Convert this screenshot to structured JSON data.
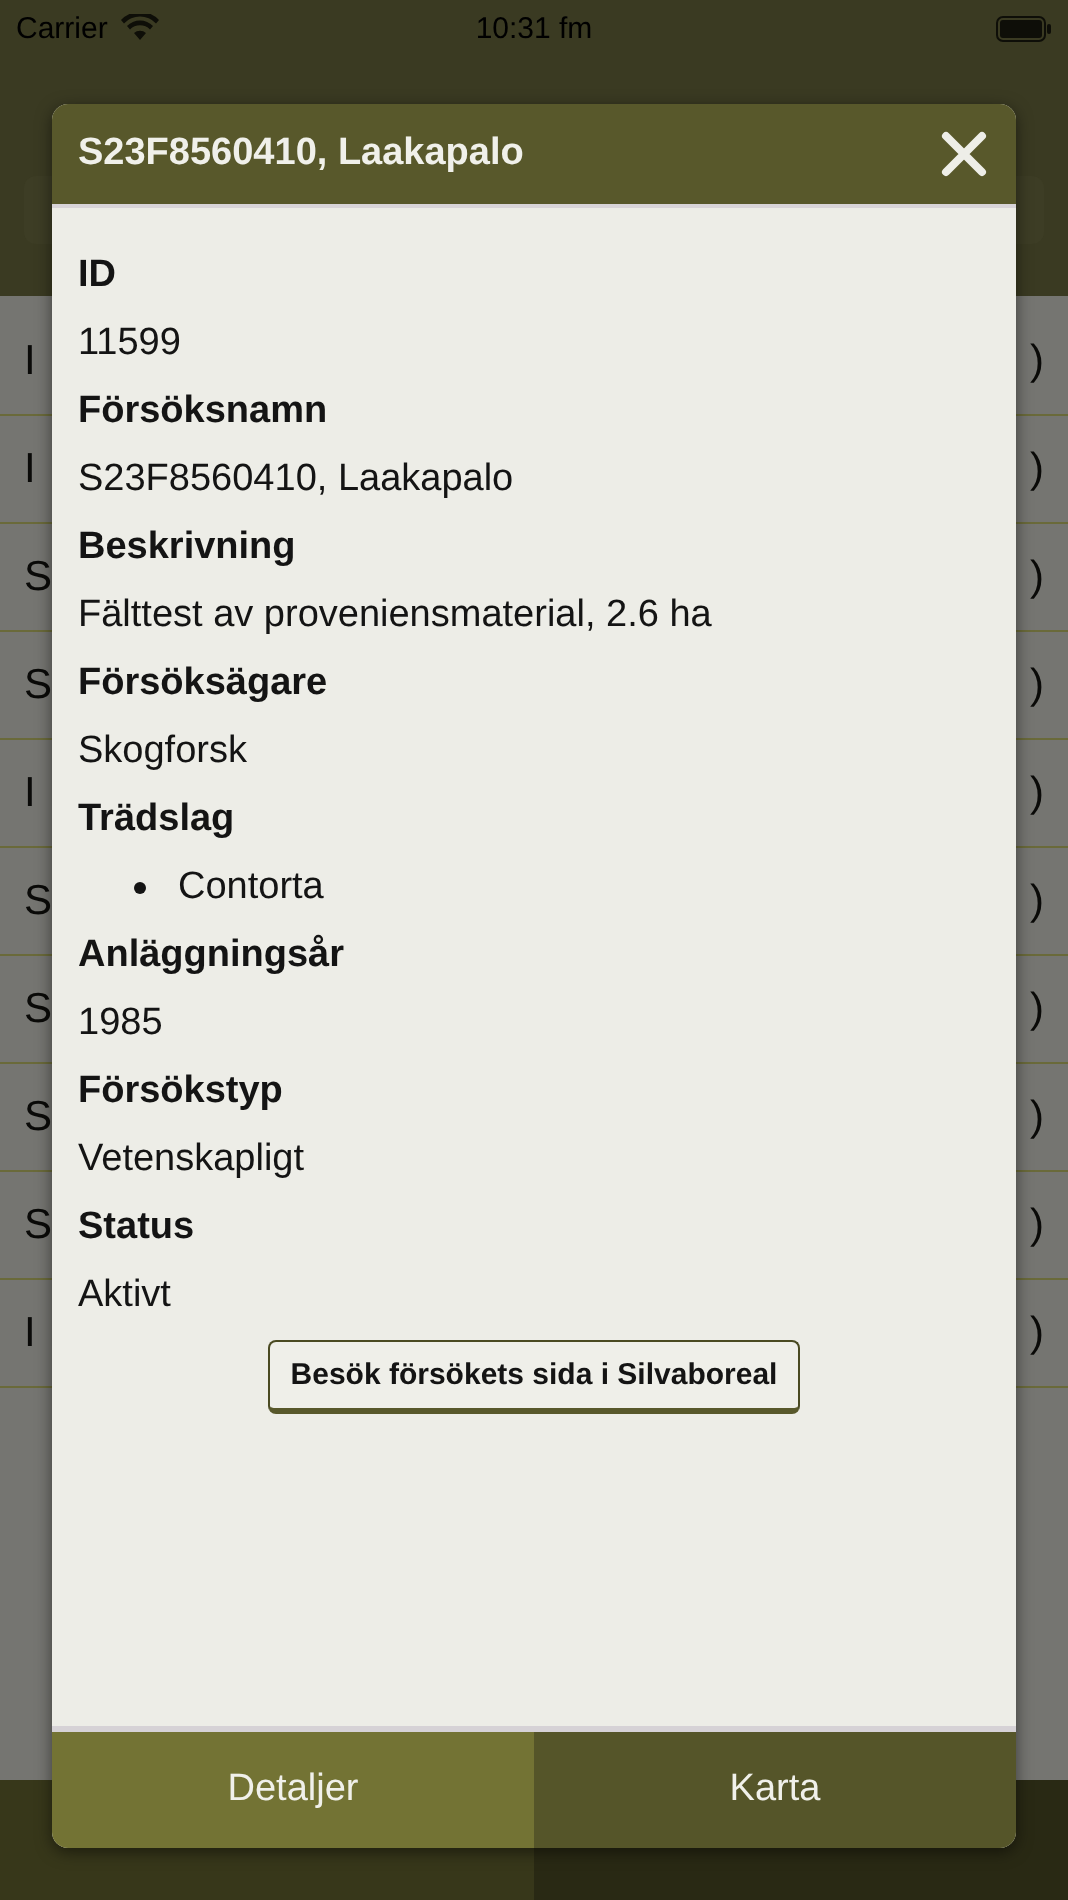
{
  "status_bar": {
    "carrier": "Carrier",
    "time": "10:31 fm"
  },
  "background": {
    "rows": [
      {
        "left": "I",
        "right": ")"
      },
      {
        "left": "I",
        "right": ")"
      },
      {
        "left": "S",
        "right": ")"
      },
      {
        "left": "S",
        "right": ")"
      },
      {
        "left": "I",
        "right": ")"
      },
      {
        "left": "S",
        "right": ")"
      },
      {
        "left": "S",
        "right": ")"
      },
      {
        "left": "S",
        "right": ")"
      },
      {
        "left": "S",
        "right": ")"
      },
      {
        "left": "I",
        "right": ")"
      }
    ]
  },
  "dialog": {
    "title": "S23F8560410, Laakapalo",
    "fields": [
      {
        "kind": "text",
        "label": "ID",
        "value": "11599"
      },
      {
        "kind": "text",
        "label": "Försöksnamn",
        "value": "S23F8560410, Laakapalo"
      },
      {
        "kind": "text",
        "label": "Beskrivning",
        "value": "Fälttest av proveniensmaterial, 2.6 ha"
      },
      {
        "kind": "text",
        "label": "Försöksägare",
        "value": "Skogforsk"
      },
      {
        "kind": "list",
        "label": "Trädslag",
        "items": [
          "Contorta"
        ]
      },
      {
        "kind": "text",
        "label": "Anläggningsår",
        "value": "1985"
      },
      {
        "kind": "text",
        "label": "Försökstyp",
        "value": "Vetenskapligt"
      },
      {
        "kind": "text",
        "label": "Status",
        "value": "Aktivt"
      }
    ],
    "link_button": "Besök försökets sida i Silvaboreal",
    "tabs": [
      {
        "label": "Detaljer",
        "selected": true
      },
      {
        "label": "Karta",
        "selected": false
      }
    ]
  }
}
